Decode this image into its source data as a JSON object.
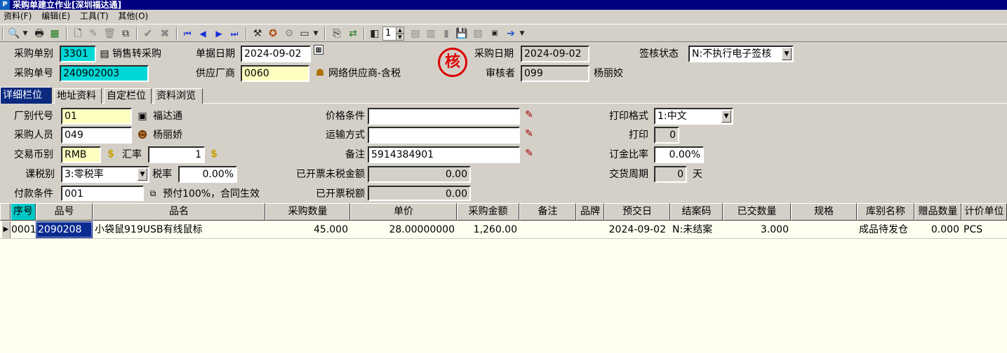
{
  "window": {
    "app_icon": "P",
    "title": "采购单建立作业[深圳福达通]"
  },
  "menu": [
    "资料(F)",
    "编辑(E)",
    "工具(T)",
    "其他(O)"
  ],
  "toolbar": {
    "record_no": "1"
  },
  "header": {
    "purchase_type_label": "采购单别",
    "purchase_type": "3301",
    "purchase_type_name": "销售转采购",
    "purchase_no_label": "采购单号",
    "purchase_no": "240902003",
    "doc_date_label": "单据日期",
    "doc_date": "2024-09-02",
    "supplier_label": "供应厂商",
    "supplier": "0060",
    "supplier_name": "网络供应商-含税",
    "stamp_char": "核",
    "purchase_date_label": "采购日期",
    "purchase_date": "2024-09-02",
    "reviewer_label": "审核者",
    "reviewer_id": "099",
    "reviewer_name": "杨丽姣",
    "sign_status_label": "签核状态",
    "sign_status": "N:不执行电子签核"
  },
  "tabs": [
    "详细栏位",
    "地址资料",
    "自定栏位",
    "资料浏览"
  ],
  "detail": {
    "factory_label": "厂别代号",
    "factory": "01",
    "factory_name": "福达通",
    "buyer_label": "采购人员",
    "buyer": "049",
    "buyer_name": "杨丽娇",
    "currency_label": "交易币别",
    "currency": "RMB",
    "rate_label": "汇率",
    "rate": "1",
    "tax_type_label": "课税别",
    "tax_type": "3:零税率",
    "tax_rate_label": "税率",
    "tax_rate": "0.00%",
    "payment_label": "付款条件",
    "payment": "001",
    "payment_desc": "预付100%，合同生效",
    "price_cond_label": "价格条件",
    "price_cond": "",
    "shipping_label": "运输方式",
    "shipping": "",
    "remark_label": "备注",
    "remark": "5914384901",
    "invoiced_untaxed_label": "已开票未税金额",
    "invoiced_untaxed": "0.00",
    "invoiced_tax_label": "已开票税额",
    "invoiced_tax": "0.00",
    "print_format_label": "打印格式",
    "print_format": "1:中文",
    "print_label": "打印",
    "print_count": "0",
    "deposit_label": "订金比率",
    "deposit": "0.00%",
    "lead_time_label": "交货周期",
    "lead_time": "0",
    "lead_time_unit": "天"
  },
  "grid": {
    "columns": [
      "序号",
      "品号",
      "品名",
      "采购数量",
      "单价",
      "采购金额",
      "备注",
      "品牌",
      "预交日",
      "结案码",
      "已交数量",
      "规格",
      "库别名称",
      "赠品数量",
      "计价单位"
    ],
    "rows": [
      [
        "0001",
        "2090208",
        "小袋鼠919USB有线鼠标",
        "45.000",
        "28.00000000",
        "1,260.00",
        "",
        "",
        "2024-09-02",
        "N:未结案",
        "3.000",
        "",
        "成品待发仓",
        "0.000",
        "PCS"
      ]
    ]
  }
}
